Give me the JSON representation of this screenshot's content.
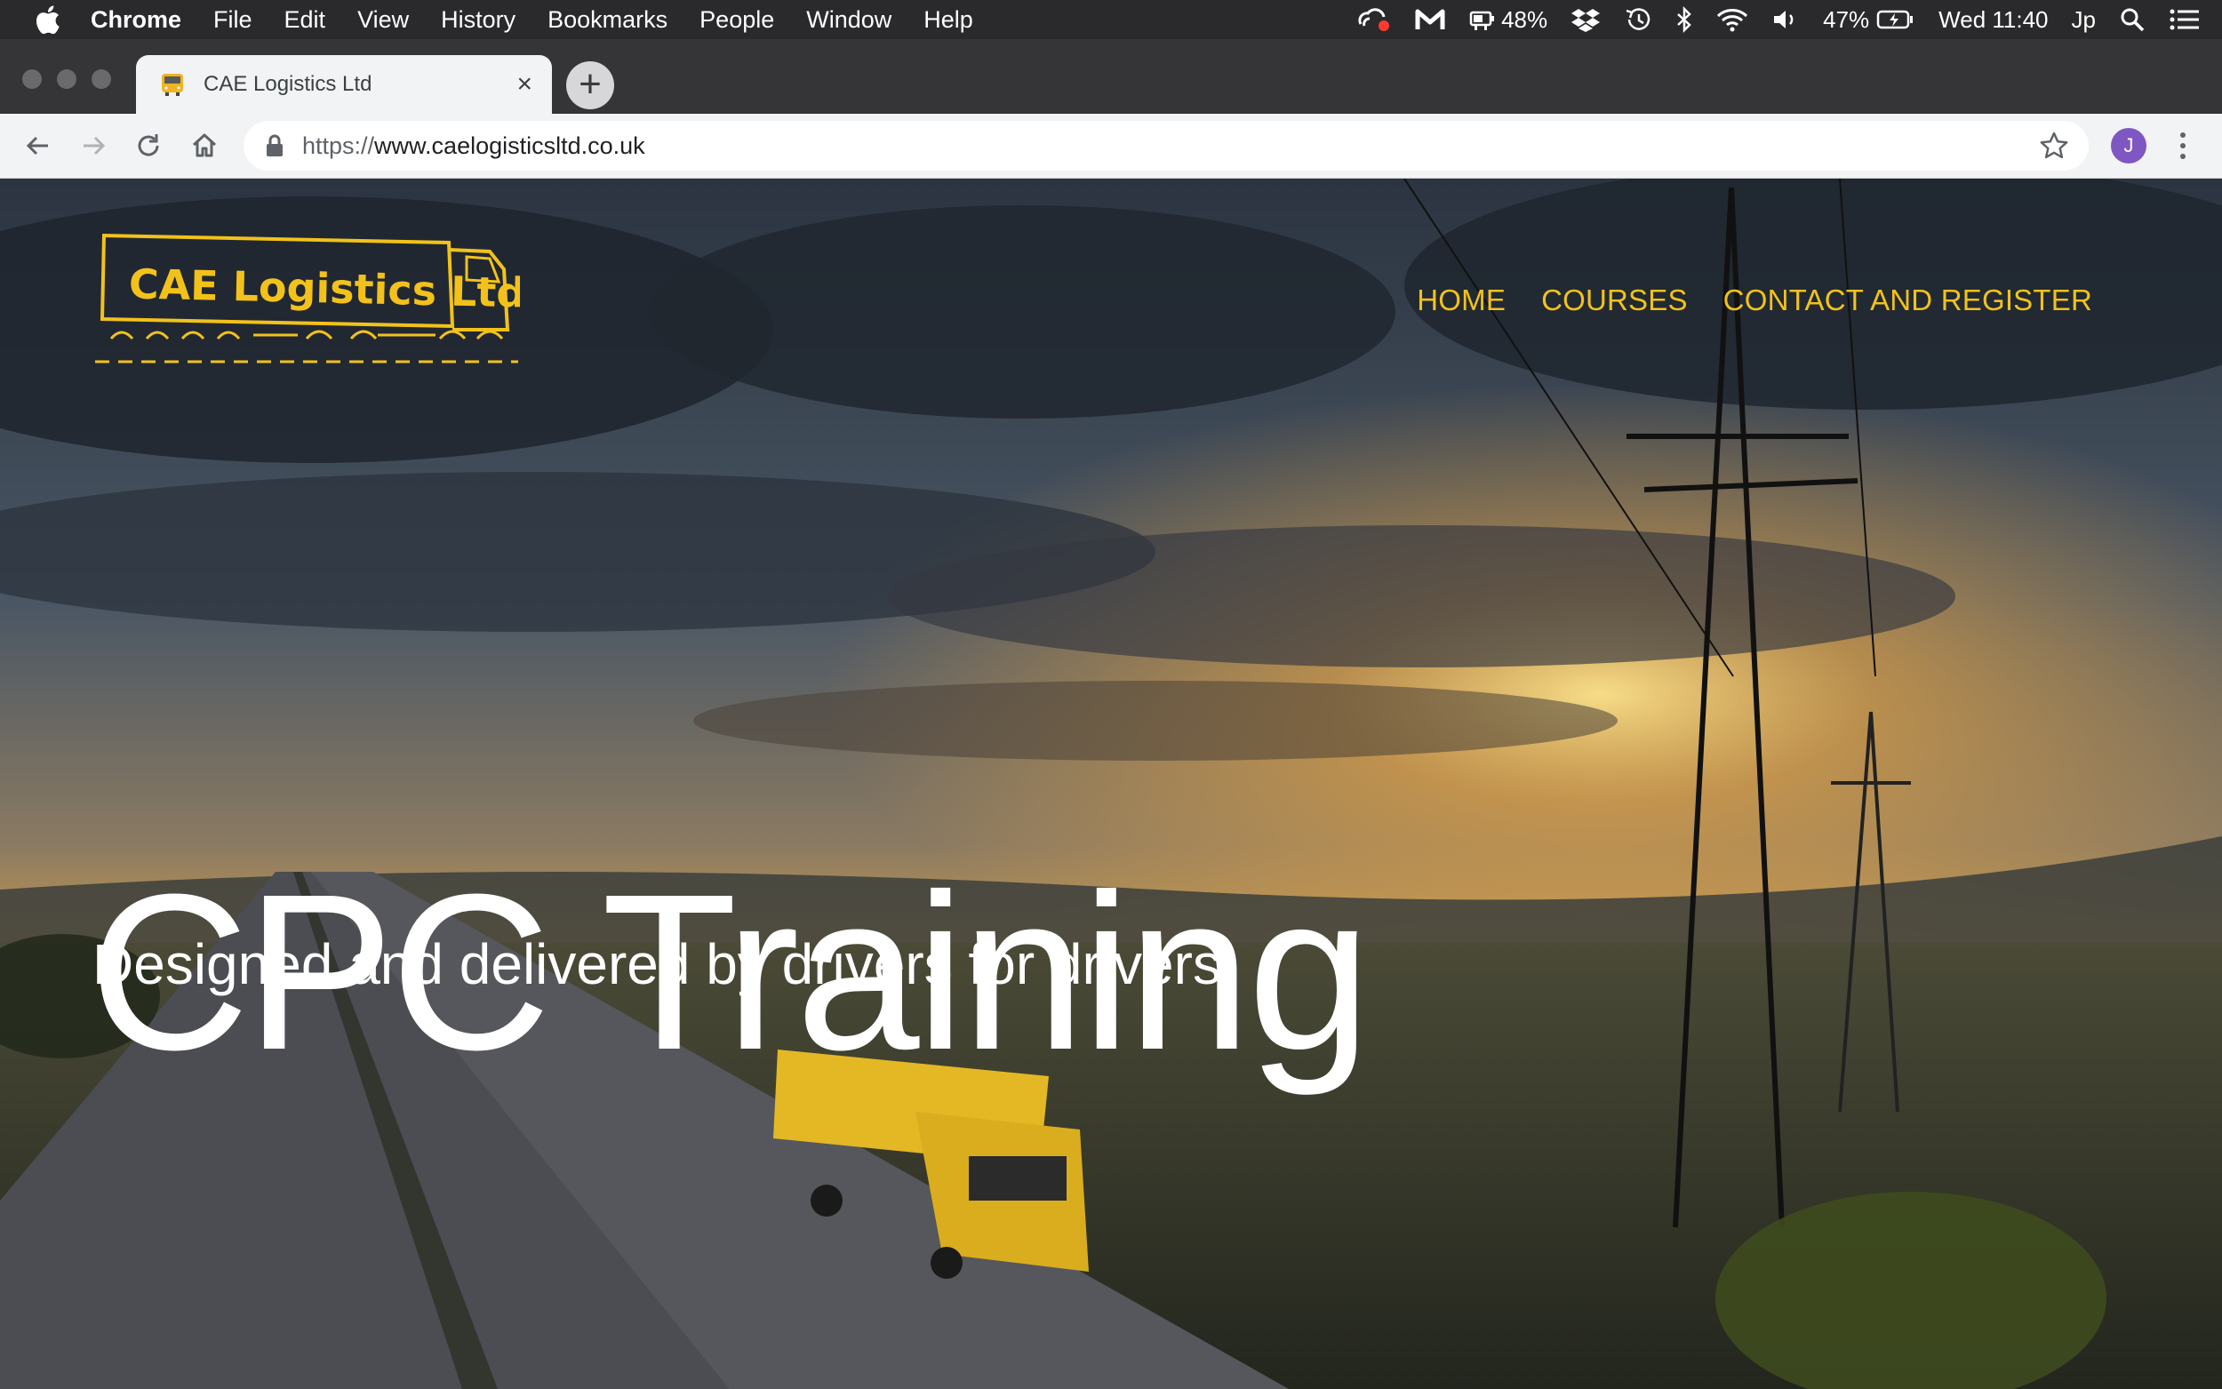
{
  "menubar": {
    "app": "Chrome",
    "items": [
      "File",
      "Edit",
      "View",
      "History",
      "Bookmarks",
      "People",
      "Window",
      "Help"
    ],
    "status": {
      "battery_app": "48%",
      "battery": "47%",
      "clock": "Wed 11:40",
      "input_method": "Jp"
    }
  },
  "browser": {
    "tab_title": "CAE Logistics Ltd",
    "new_tab_label": "+",
    "close_label": "×",
    "url_scheme": "https://",
    "url_host": "www.caelogisticsltd.co.uk",
    "profile_initial": "J"
  },
  "site": {
    "logo_text": "CAE Logistics Ltd",
    "nav": [
      "HOME",
      "COURSES",
      "CONTACT AND REGISTER"
    ],
    "hero_title": "CPC Training",
    "hero_subtitle": "Designed and delivered by drivers for drivers"
  },
  "colors": {
    "accent_yellow": "#f2c21b",
    "menubar_bg": "#2a2a2c",
    "toolbar_bg": "#f1f3f4"
  }
}
